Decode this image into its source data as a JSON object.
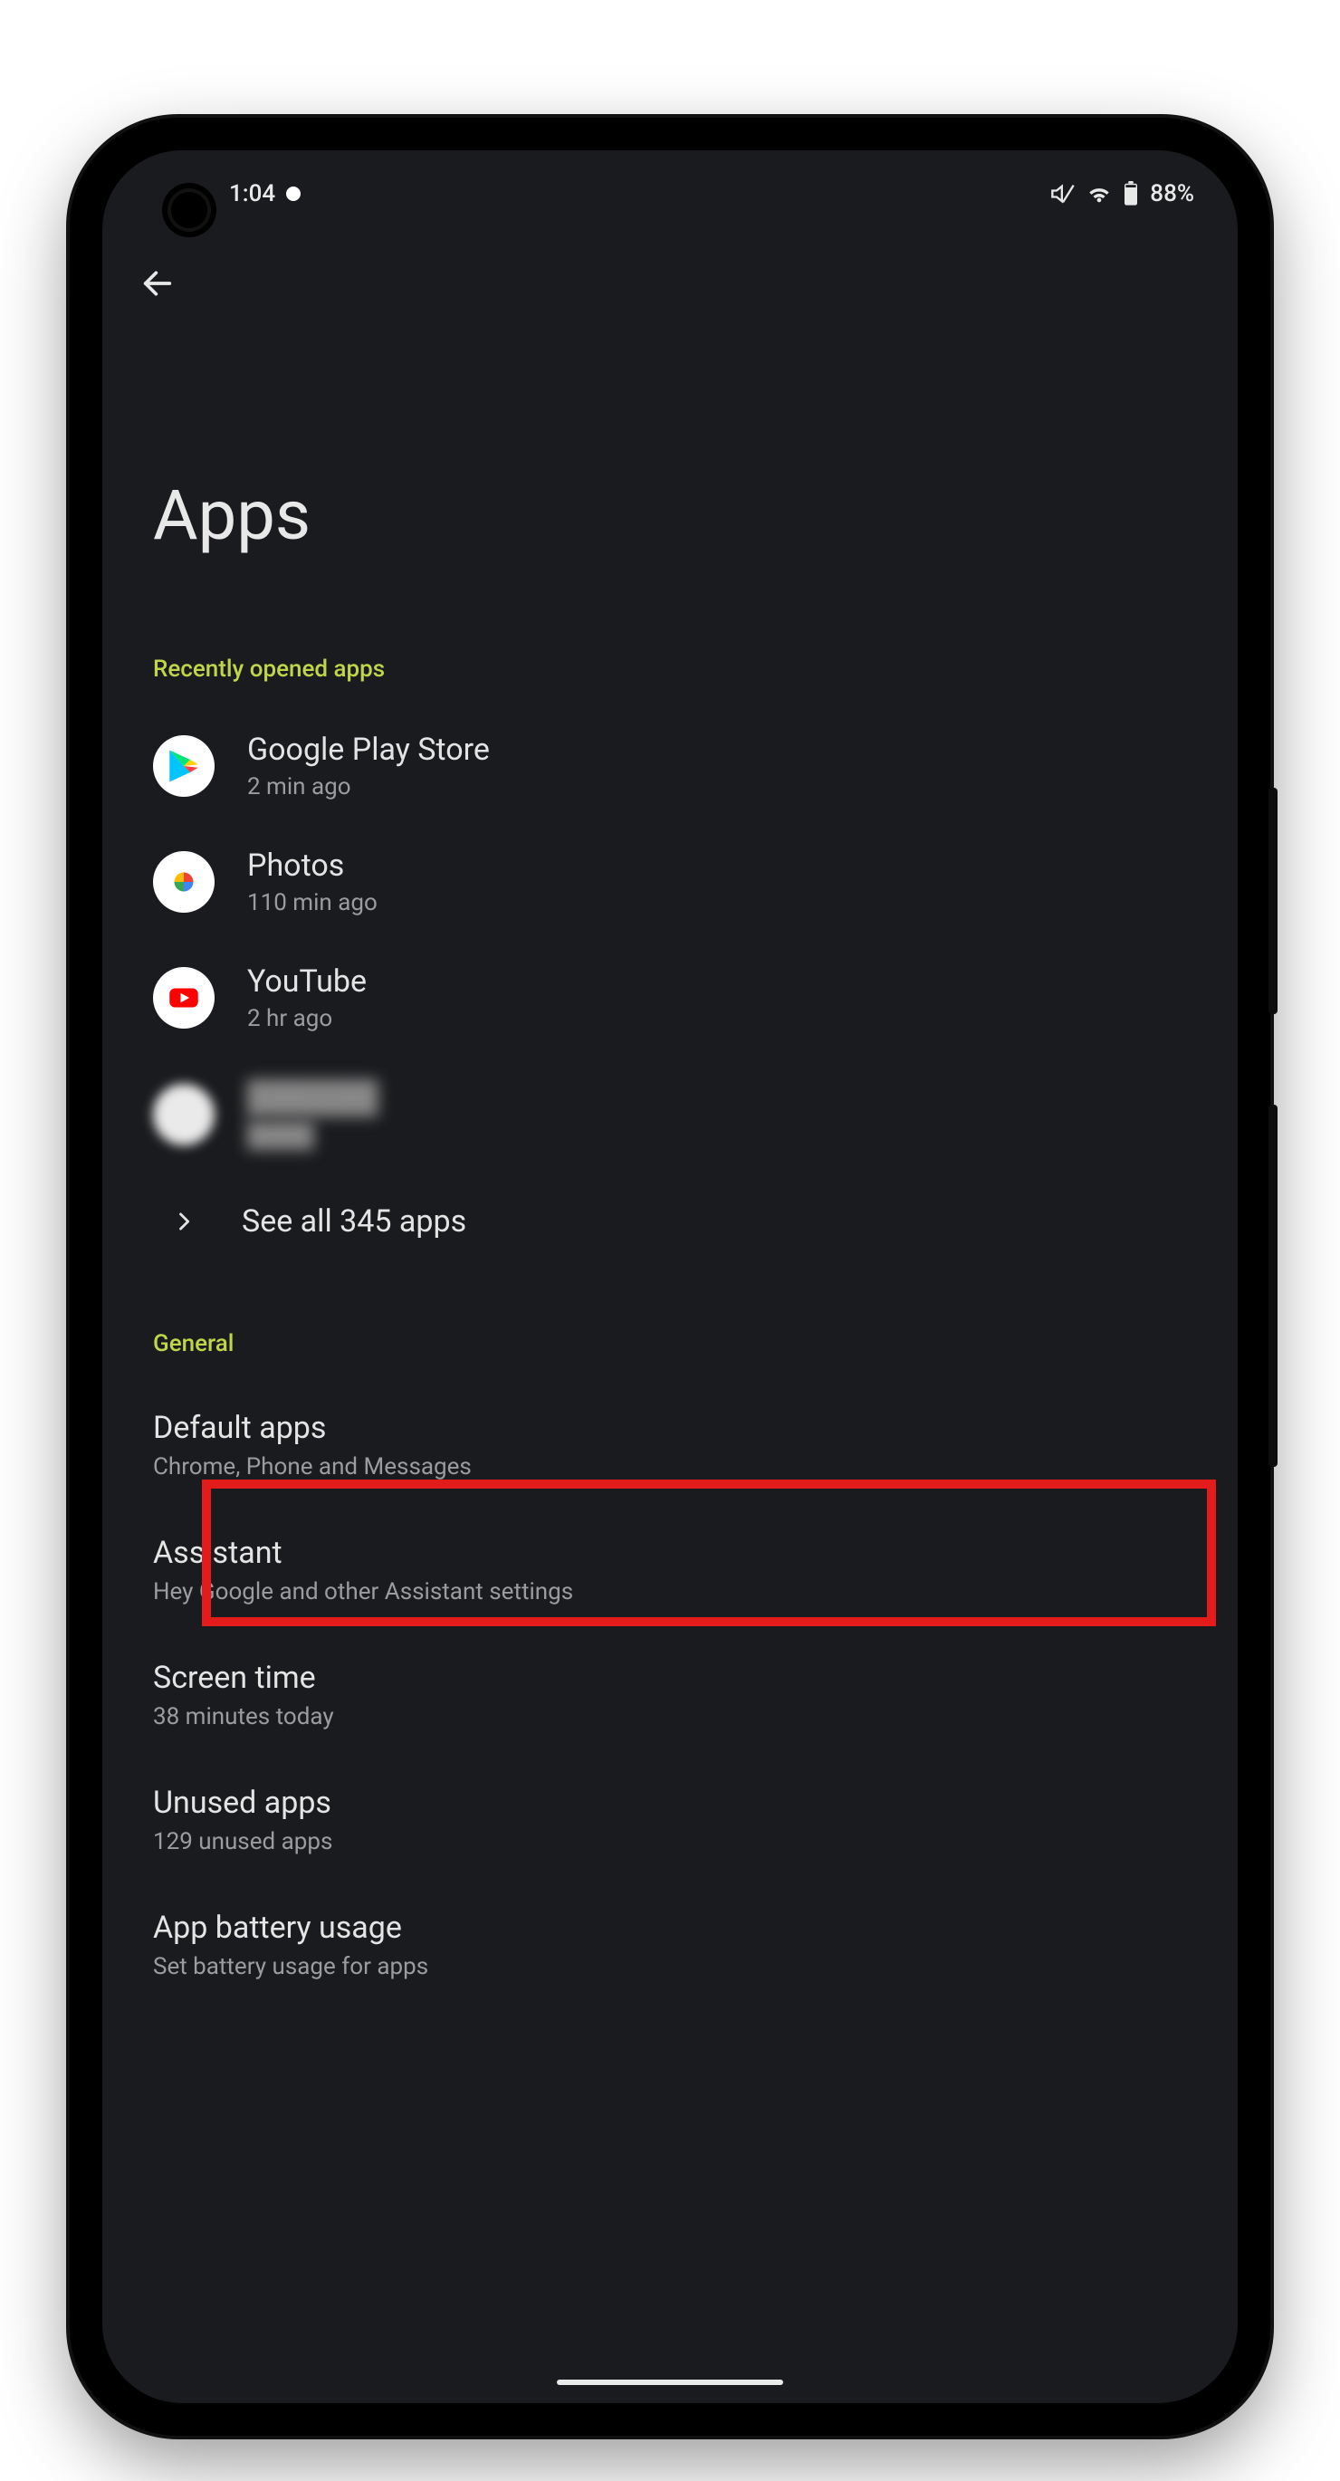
{
  "statusbar": {
    "time": "1:04",
    "battery_pct": "88%"
  },
  "page": {
    "title": "Apps"
  },
  "sections": {
    "recent_header": "Recently opened apps",
    "general_header": "General"
  },
  "recent_apps": [
    {
      "name": "Google Play Store",
      "sub": "2 min ago",
      "icon": "play-store"
    },
    {
      "name": "Photos",
      "sub": "110 min ago",
      "icon": "photos"
    },
    {
      "name": "YouTube",
      "sub": "2 hr ago",
      "icon": "youtube"
    },
    {
      "name": "██████",
      "sub": "████",
      "icon": "blurred"
    }
  ],
  "see_all": {
    "label": "See all 345 apps"
  },
  "general": [
    {
      "title": "Default apps",
      "sub": "Chrome, Phone and Messages"
    },
    {
      "title": "Assistant",
      "sub": "Hey Google and other Assistant settings"
    },
    {
      "title": "Screen time",
      "sub": "38 minutes today"
    },
    {
      "title": "Unused apps",
      "sub": "129 unused apps"
    },
    {
      "title": "App battery usage",
      "sub": "Set battery usage for apps"
    }
  ],
  "annotation": {
    "highlight": "see-all-apps"
  }
}
